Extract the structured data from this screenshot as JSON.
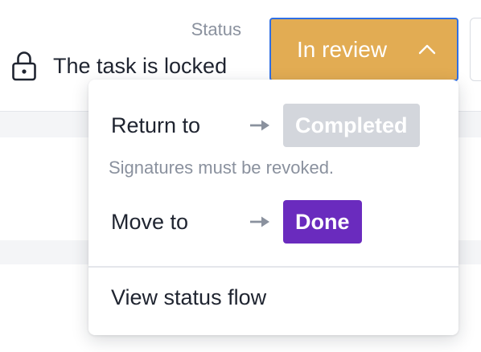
{
  "header": {
    "status_label": "Status",
    "lock_message": "The task is locked",
    "lock_icon": "padlock-icon",
    "current_status": "In review",
    "current_status_color": "#e2ac53",
    "chevron_icon": "chevron-up-icon"
  },
  "dropdown": {
    "items": [
      {
        "label": "Return to",
        "arrow_icon": "arrow-right-icon",
        "target_status": "Completed",
        "target_color": "#d3d6dc",
        "enabled": false,
        "hint": "Signatures must be revoked."
      },
      {
        "label": "Move to",
        "arrow_icon": "arrow-right-icon",
        "target_status": "Done",
        "target_color": "#6a2bbe",
        "enabled": true
      }
    ],
    "footer_link": "View status flow"
  },
  "colors": {
    "focus_ring": "#2f6fe4",
    "muted_text": "#8a919e"
  }
}
